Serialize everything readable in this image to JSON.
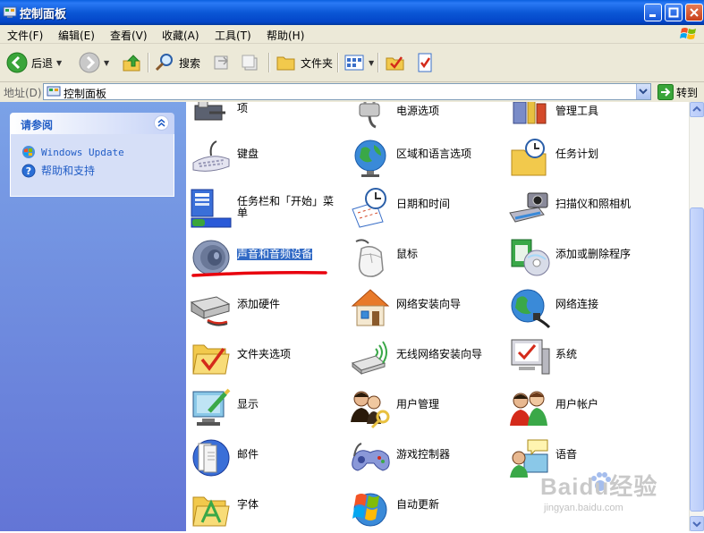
{
  "window": {
    "title": "控制面板"
  },
  "menu": [
    "文件(F)",
    "编辑(E)",
    "查看(V)",
    "收藏(A)",
    "工具(T)",
    "帮助(H)"
  ],
  "toolbar": {
    "back": "后退",
    "search": "搜索",
    "folders": "文件夹"
  },
  "address": {
    "label": "地址(D)",
    "value": "控制面板",
    "go": "转到"
  },
  "see_also": {
    "title": "请参阅",
    "links": [
      "Windows Update",
      "帮助和支持"
    ]
  },
  "items": [
    {
      "label": "电话和调制解调器选项",
      "icon": "phone-modem-icon"
    },
    {
      "label": "电源选项",
      "icon": "power-plug-icon"
    },
    {
      "label": "管理工具",
      "icon": "admin-tools-icon"
    },
    {
      "label": "键盘",
      "icon": "keyboard-icon"
    },
    {
      "label": "区域和语言选项",
      "icon": "globe-icon"
    },
    {
      "label": "任务计划",
      "icon": "scheduled-tasks-icon"
    },
    {
      "label": "任务栏和「开始」菜单",
      "icon": "taskbar-icon"
    },
    {
      "label": "日期和时间",
      "icon": "calendar-clock-icon"
    },
    {
      "label": "扫描仪和照相机",
      "icon": "scanner-camera-icon"
    },
    {
      "label": "声音和音频设备",
      "icon": "speaker-icon",
      "selected": true
    },
    {
      "label": "鼠标",
      "icon": "mouse-icon"
    },
    {
      "label": "添加或删除程序",
      "icon": "add-remove-programs-icon"
    },
    {
      "label": "添加硬件",
      "icon": "add-hardware-icon"
    },
    {
      "label": "网络安装向导",
      "icon": "network-home-icon"
    },
    {
      "label": "网络连接",
      "icon": "network-globe-icon"
    },
    {
      "label": "文件夹选项",
      "icon": "folder-check-icon"
    },
    {
      "label": "无线网络安装向导",
      "icon": "wireless-usb-icon"
    },
    {
      "label": "系统",
      "icon": "system-monitor-icon"
    },
    {
      "label": "显示",
      "icon": "display-icon"
    },
    {
      "label": "用户管理",
      "icon": "users-key-icon"
    },
    {
      "label": "用户帐户",
      "icon": "user-accounts-icon"
    },
    {
      "label": "邮件",
      "icon": "mail-icon"
    },
    {
      "label": "游戏控制器",
      "icon": "gamepad-icon"
    },
    {
      "label": "语音",
      "icon": "speech-icon"
    },
    {
      "label": "字体",
      "icon": "fonts-folder-icon"
    },
    {
      "label": "自动更新",
      "icon": "windows-update-icon"
    }
  ],
  "watermark": {
    "text": "Baidu经验",
    "url": "jingyan.baidu.com"
  },
  "colors": {
    "titlebar": "#0b57d6",
    "taskpane": "#6f8fe0",
    "selection": "#316ac5",
    "annotation": "#e8000d"
  }
}
